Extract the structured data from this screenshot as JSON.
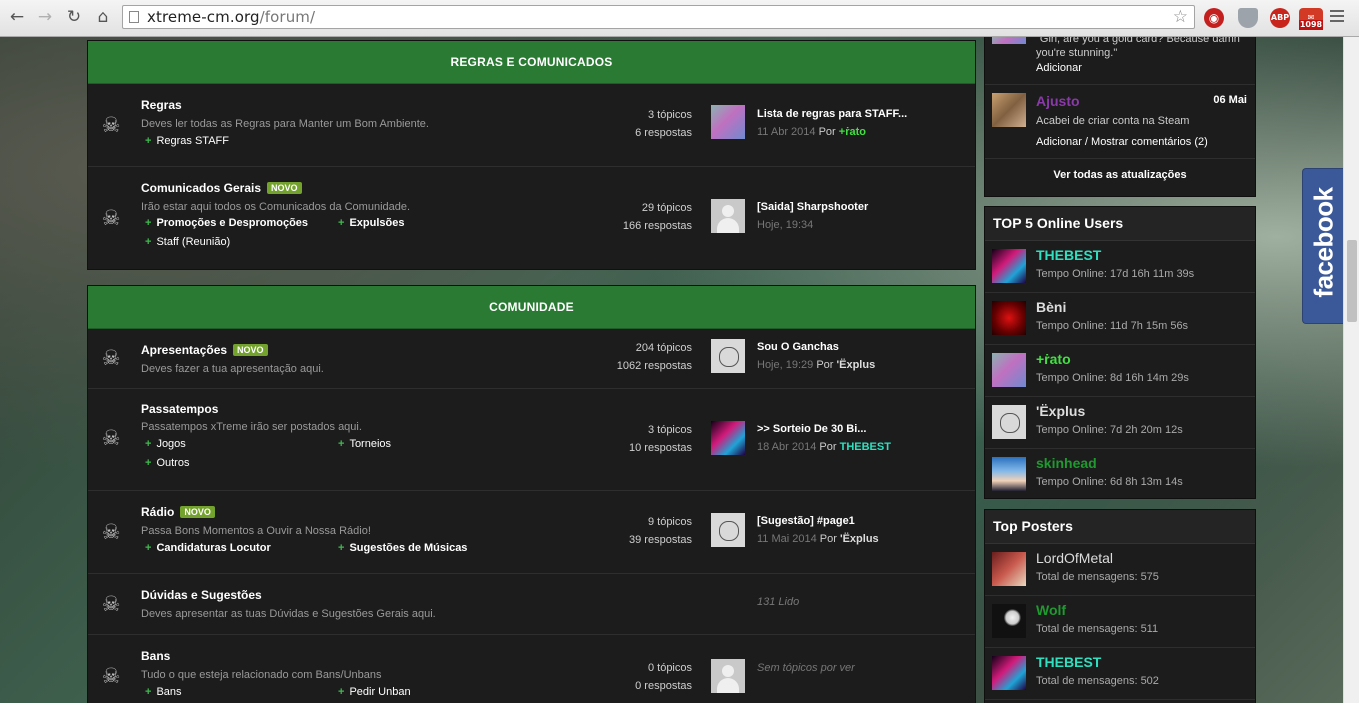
{
  "browser": {
    "url_domain": "xtreme-cm.org",
    "url_path": "/forum/",
    "nav": {
      "back": "←",
      "forward": "→",
      "reload": "↻",
      "home": "⌂"
    },
    "star": "☆",
    "extensions": [
      {
        "name": "lastpass-icon",
        "label": "◉"
      },
      {
        "name": "ghostery-icon",
        "label": ""
      },
      {
        "name": "adblock-plus-icon",
        "label": "ABP"
      },
      {
        "name": "gmail-icon",
        "label": "✉",
        "badge": "1098"
      }
    ]
  },
  "categories": [
    {
      "title": "REGRAS E COMUNICADOS",
      "forums": [
        {
          "title": "Regras",
          "novo": false,
          "desc": "Deves ler todas as Regras para Manter um Bom Ambiente.",
          "subforums": [
            "Regras STAFF"
          ],
          "topics": "3 tópicos",
          "replies": "6 respostas",
          "last": {
            "title": "Lista de regras para STAFF...",
            "date": "11 Abr 2014",
            "by": "Por",
            "user": "+ṙato",
            "user_color": "#43e043",
            "avatar": "pink"
          }
        },
        {
          "title": "Comunicados Gerais",
          "novo": true,
          "novo_label": "NOVO",
          "desc": "Irão estar aqui todos os Comunicados da Comunidade.",
          "subforums": [
            "Promoções e Despromoções",
            "Expulsões",
            "Staff (Reunião)"
          ],
          "topics": "29 tópicos",
          "replies": "166 respostas",
          "last": {
            "title": "[Saida] Sharpshooter",
            "date": "Hoje, 19:34",
            "by": "",
            "user": "",
            "avatar": "default"
          }
        }
      ]
    },
    {
      "title": "COMUNIDADE",
      "forums": [
        {
          "title": "Apresentações",
          "novo": true,
          "novo_label": "NOVO",
          "desc": "Deves fazer a tua apresentação aqui.",
          "subforums": [],
          "topics": "204 tópicos",
          "replies": "1062 respostas",
          "last": {
            "title": "Sou O Ganchas",
            "date": "Hoje, 19:29",
            "by": "Por",
            "user": "'Ëxplus",
            "user_color": "#dddddd",
            "avatar": "alien"
          }
        },
        {
          "title": "Passatempos",
          "novo": false,
          "desc": "Passatempos xTreme irão ser postados aqui.",
          "subforums": [
            "Jogos",
            "Torneios",
            "Outros"
          ],
          "topics": "3 tópicos",
          "replies": "10 respostas",
          "last": {
            "title": ">> Sorteio De 30 Bi...",
            "date": "18 Abr 2014",
            "by": "Por",
            "user": "THEBEST",
            "user_color": "#2fe0c0",
            "avatar": "neon"
          }
        },
        {
          "title": "Rádio",
          "novo": true,
          "novo_label": "NOVO",
          "desc": "Passa Bons Momentos a Ouvir a Nossa Rádio!",
          "subforums": [
            "Candidaturas Locutor",
            "Sugestões de Músicas"
          ],
          "topics": "9 tópicos",
          "replies": "39 respostas",
          "last": {
            "title": "[Sugestão] #page1",
            "date": "11 Mai 2014",
            "by": "Por",
            "user": "'Ëxplus",
            "user_color": "#dddddd",
            "avatar": "alien"
          }
        },
        {
          "title": "Dúvidas e Sugestões",
          "novo": false,
          "desc": "Deves apresentar as tuas Dúvidas e Sugestões Gerais aqui.",
          "subforums": [],
          "topics": "",
          "replies": "",
          "empty_text": "131 Lido"
        },
        {
          "title": "Bans",
          "novo": false,
          "desc": "Tudo o que esteja relacionado com Bans/Unbans",
          "subforums": [
            "Bans",
            "Pedir Unban"
          ],
          "topics": "0 tópicos",
          "replies": "0 respostas",
          "last": {
            "title": "",
            "date": "",
            "avatar": "default"
          },
          "empty_text": "Sem tópicos por ver"
        }
      ]
    }
  ],
  "status_updates": {
    "partial_text_line1": "\"Girl, are you a gold card? Because damn",
    "partial_text_line2": "you're stunning.\"",
    "partial_action": "Adicionar",
    "item": {
      "user": "Ajusto",
      "date": "06 Mai",
      "text": "Acabei de criar conta na Steam",
      "actions": "Adicionar / Mostrar comentários (2)"
    },
    "view_all": "Ver todas as atualizações"
  },
  "top_online": {
    "title": "TOP 5 Online Users",
    "users": [
      {
        "name": "THEBEST",
        "color": "#2fe0c0",
        "info": "Tempo Online: 17d 16h 11m 39s",
        "avatar": "neon"
      },
      {
        "name": "Bèni",
        "color": "#dddddd",
        "info": "Tempo Online: 11d 7h 15m 56s",
        "avatar": "red"
      },
      {
        "name": "+ṙato",
        "color": "#43e043",
        "info": "Tempo Online: 8d 16h 14m 29s",
        "avatar": "pink"
      },
      {
        "name": "'Ëxplus",
        "color": "#dddddd",
        "info": "Tempo Online: 7d 2h 20m 12s",
        "avatar": "alien"
      },
      {
        "name": "skinhead",
        "color": "#1f9a30",
        "info": "Tempo Online: 6d 8h 13m 14s",
        "avatar": "anime"
      }
    ]
  },
  "top_posters": {
    "title": "Top Posters",
    "users": [
      {
        "name": "LordOfMetal",
        "color": "#dddddd",
        "info": "Total de mensagens: 575",
        "avatar": "metal"
      },
      {
        "name": "Wolf",
        "color": "#1f9a30",
        "info": "Total de mensagens: 511",
        "avatar": "wolf"
      },
      {
        "name": "THEBEST",
        "color": "#2fe0c0",
        "info": "Total de mensagens: 502",
        "avatar": "neon"
      }
    ]
  },
  "facebook_tab": "facebook",
  "colors": {
    "category_header": "#2a7a34",
    "novo_badge": "#73a22d",
    "plus": "#3fb94f",
    "facebook": "#3b5998"
  }
}
